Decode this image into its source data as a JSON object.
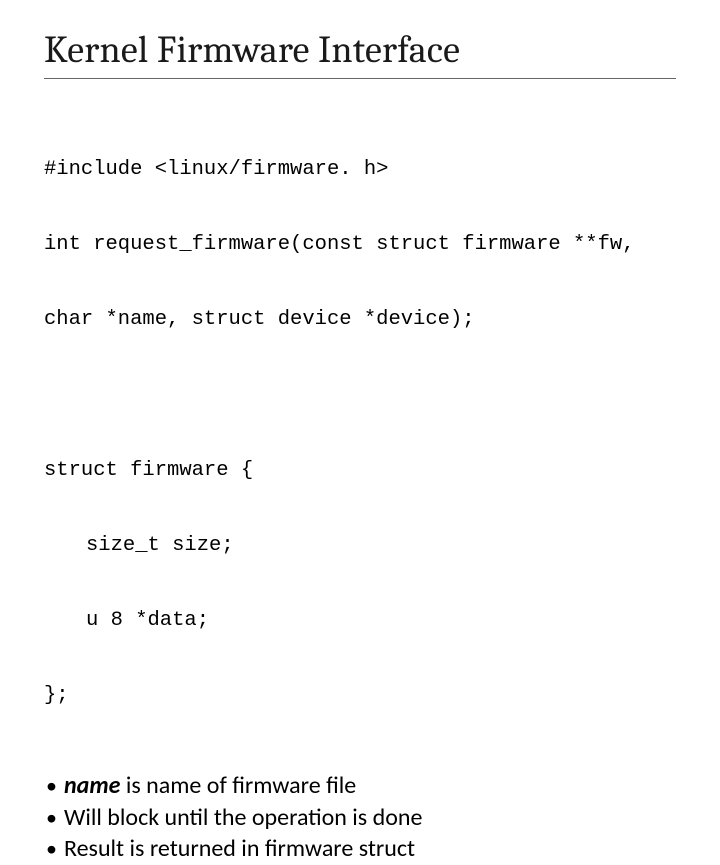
{
  "title": "Kernel Firmware Interface",
  "code1": {
    "l1": "#include <linux/firmware. h>",
    "l2": "int request_firmware(const struct firmware **fw,",
    "l3": "char *name, struct device *device);"
  },
  "code2": {
    "l1": "struct firmware {",
    "l2": "size_t size;",
    "l3": "u 8 *data;",
    "l4": "};"
  },
  "bullets": {
    "b1_name": "name",
    "b1_rest": " is name of firmware file",
    "b2": "Will block until the operation is done",
    "b3": "Result is returned in firmware struct"
  }
}
